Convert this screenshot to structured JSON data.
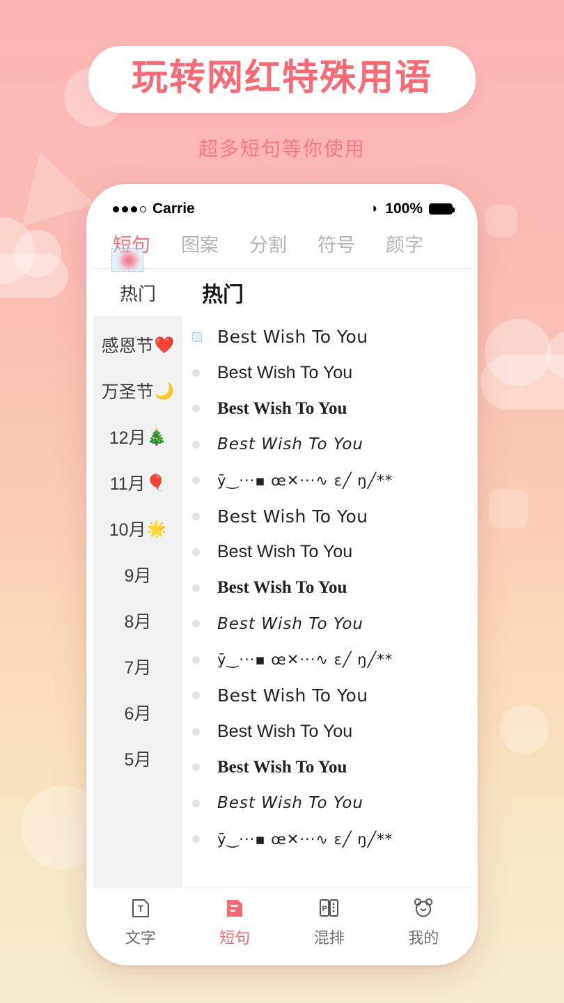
{
  "promo": {
    "title": "玩转网红特殊用语",
    "subtitle": "超多短句等你使用",
    "accent_color": "#fa6a74"
  },
  "statusbar": {
    "carrier": "Carrie",
    "battery_percent": "100%",
    "signal_icon": "signal-dots-icon",
    "location_icon": "location-arrow-icon",
    "battery_icon": "battery-full-icon"
  },
  "top_tabs": [
    {
      "label": "短句",
      "active": true
    },
    {
      "label": "图案",
      "active": false
    },
    {
      "label": "分割",
      "active": false
    },
    {
      "label": "符号",
      "active": false
    },
    {
      "label": "颜字",
      "active": false
    }
  ],
  "section": {
    "sidebar_header": "热门",
    "list_header": "热门"
  },
  "sidebar": {
    "items": [
      {
        "label": "感恩节",
        "emoji": "❤️"
      },
      {
        "label": "万圣节",
        "emoji": "🌙"
      },
      {
        "label": "12月",
        "emoji": "🎄"
      },
      {
        "label": "11月",
        "emoji": "🎈"
      },
      {
        "label": "10月",
        "emoji": "🌟"
      },
      {
        "label": "9月",
        "emoji": ""
      },
      {
        "label": "8月",
        "emoji": ""
      },
      {
        "label": "7月",
        "emoji": ""
      },
      {
        "label": "6月",
        "emoji": ""
      },
      {
        "label": "5月",
        "emoji": ""
      }
    ]
  },
  "list": {
    "items": [
      {
        "text": "Best Wish To You",
        "style": "st-round",
        "selected": true
      },
      {
        "text": "Best Wish To You",
        "style": "st-sans",
        "selected": false
      },
      {
        "text": "Best Wish To You",
        "style": "st-serif",
        "selected": false
      },
      {
        "text": "Best Wish To You",
        "style": "st-hand",
        "selected": false
      },
      {
        "text": "ȳ‿···▪ œ✕···∿ ɛ╱ ŋ╱**",
        "style": "st-sym",
        "selected": false
      },
      {
        "text": "Best Wish To You",
        "style": "st-round",
        "selected": false
      },
      {
        "text": "Best Wish To You",
        "style": "st-sans",
        "selected": false
      },
      {
        "text": "Best Wish To You",
        "style": "st-serif",
        "selected": false
      },
      {
        "text": "Best Wish To You",
        "style": "st-hand",
        "selected": false
      },
      {
        "text": "ȳ‿···▪ œ✕···∿ ɛ╱ ŋ╱**",
        "style": "st-sym",
        "selected": false
      },
      {
        "text": "Best Wish To You",
        "style": "st-round",
        "selected": false
      },
      {
        "text": "Best Wish To You",
        "style": "st-sans",
        "selected": false
      },
      {
        "text": "Best Wish To You",
        "style": "st-serif",
        "selected": false
      },
      {
        "text": "Best Wish To You",
        "style": "st-hand",
        "selected": false
      },
      {
        "text": "ȳ‿···▪ œ✕···∿ ɛ╱ ŋ╱**",
        "style": "st-sym",
        "selected": false
      }
    ]
  },
  "bottom_nav": {
    "items": [
      {
        "label": "文字",
        "icon": "text-card-icon",
        "active": false
      },
      {
        "label": "短句",
        "icon": "phrase-card-icon",
        "active": true
      },
      {
        "label": "混排",
        "icon": "mixed-layout-icon",
        "active": false
      },
      {
        "label": "我的",
        "icon": "bear-profile-icon",
        "active": false
      }
    ]
  }
}
